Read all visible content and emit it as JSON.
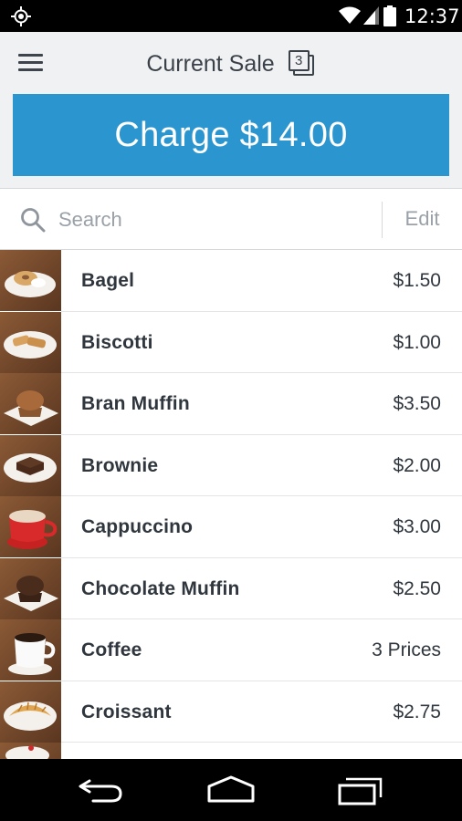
{
  "status_bar": {
    "time": "12:37"
  },
  "header": {
    "title": "Current Sale",
    "ticket_count": "3"
  },
  "charge": {
    "label": "Charge $14.00"
  },
  "search": {
    "placeholder": "Search",
    "edit_label": "Edit"
  },
  "items": [
    {
      "name": "Bagel",
      "price": "$1.50",
      "icon": "bagel"
    },
    {
      "name": "Biscotti",
      "price": "$1.00",
      "icon": "biscotti"
    },
    {
      "name": "Bran Muffin",
      "price": "$3.50",
      "icon": "muffin"
    },
    {
      "name": "Brownie",
      "price": "$2.00",
      "icon": "brownie"
    },
    {
      "name": "Cappuccino",
      "price": "$3.00",
      "icon": "cappuccino"
    },
    {
      "name": "Chocolate Muffin",
      "price": "$2.50",
      "icon": "chocolate-muffin"
    },
    {
      "name": "Coffee",
      "price": "3 Prices",
      "icon": "coffee"
    },
    {
      "name": "Croissant",
      "price": "$2.75",
      "icon": "croissant"
    },
    {
      "name": "",
      "price": "",
      "icon": "partial"
    }
  ],
  "colors": {
    "accent": "#2b95cf",
    "text": "#2f363d",
    "muted": "#9aa1a8"
  }
}
